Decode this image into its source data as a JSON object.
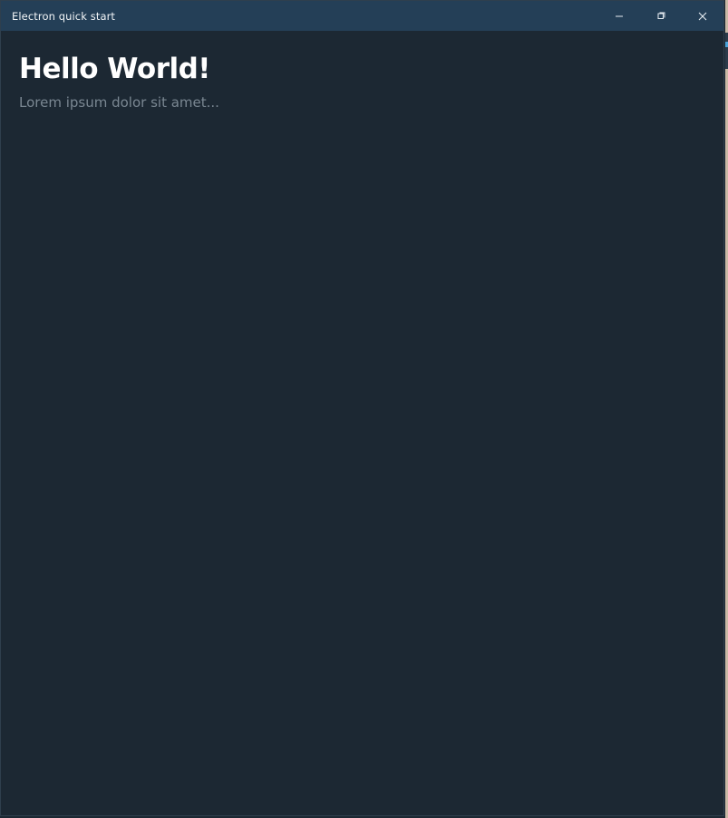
{
  "window": {
    "title": "Electron quick start"
  },
  "controls": {
    "minimize_icon": "minimize-icon",
    "restore_icon": "restore-icon",
    "close_icon": "close-icon"
  },
  "main": {
    "heading": "Hello World!",
    "paragraph": "Lorem ipsum dolor sit amet..."
  },
  "colors": {
    "titlebar_bg": "#243f57",
    "window_bg": "#1c2833",
    "heading": "#ffffff",
    "paragraph": "#7a8792"
  }
}
